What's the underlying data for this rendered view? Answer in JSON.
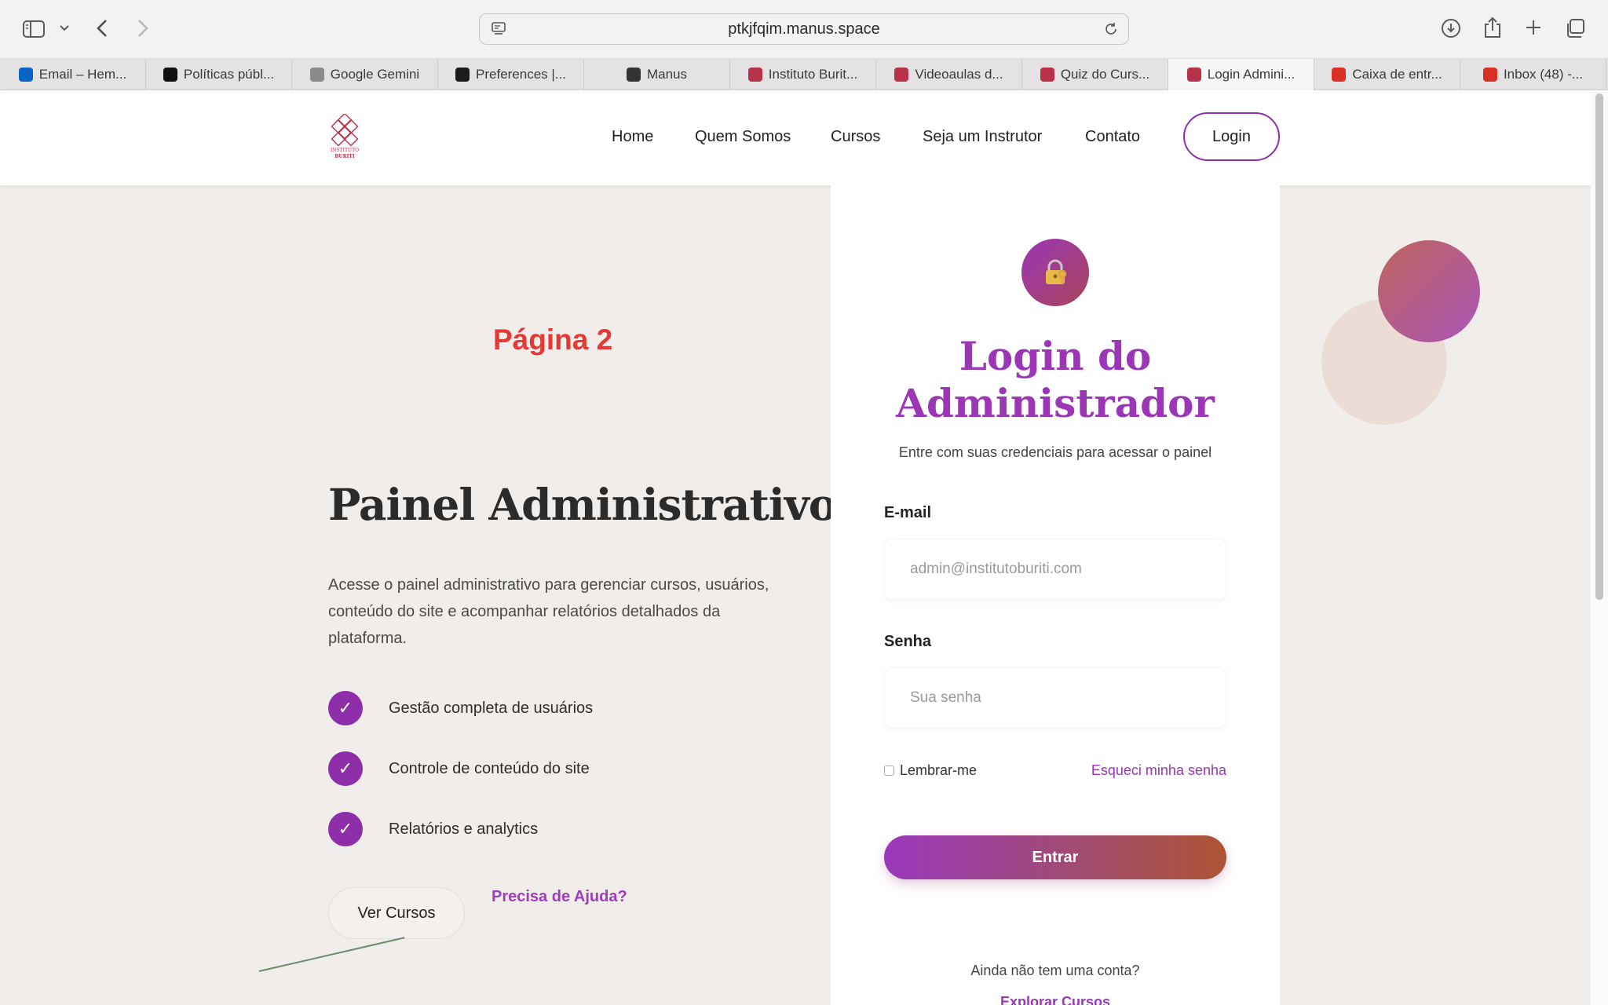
{
  "browser": {
    "url": "ptkjfqim.manus.space",
    "tabs": [
      {
        "label": "Email – Hem...",
        "icon": "outlook-icon",
        "color": "#0a64c4"
      },
      {
        "label": "Políticas públ...",
        "icon": "openai-icon",
        "color": "#111111"
      },
      {
        "label": "Google Gemini",
        "icon": "gemini-icon",
        "color": "#8a8a8a"
      },
      {
        "label": "Preferences |...",
        "icon": "bolt-icon",
        "color": "#1b1b1b"
      },
      {
        "label": "Manus",
        "icon": "manus-icon",
        "color": "#333333"
      },
      {
        "label": "Instituto Burit...",
        "icon": "buriti-icon",
        "color": "#b8334a"
      },
      {
        "label": "Videoaulas d...",
        "icon": "buriti-icon",
        "color": "#b8334a"
      },
      {
        "label": "Quiz do Curs...",
        "icon": "buriti-icon",
        "color": "#b8334a"
      },
      {
        "label": "Login Admini...",
        "icon": "buriti-icon",
        "color": "#b8334a"
      },
      {
        "label": "Caixa de entr...",
        "icon": "gmail-icon",
        "color": "#d93025"
      },
      {
        "label": "Inbox (48) -...",
        "icon": "gmail-icon",
        "color": "#d93025"
      }
    ],
    "active_tab_index": 8
  },
  "site": {
    "logo_text_1": "INSTITUTO",
    "logo_text_2": "BURITI",
    "nav": {
      "home": "Home",
      "quem_somos": "Quem Somos",
      "cursos": "Cursos",
      "instrutor": "Seja um Instrutor",
      "contato": "Contato",
      "login": "Login"
    }
  },
  "hero": {
    "page_label": "Página 2",
    "title": "Painel Administrativo",
    "description": "Acesse o painel administrativo para gerenciar cursos, usuários, conteúdo do site e acompanhar relatórios detalhados da plataforma.",
    "features": [
      "Gestão completa de usuários",
      "Controle de conteúdo do site",
      "Relatórios e analytics"
    ],
    "check_glyph": "✓",
    "ver_cursos": "Ver Cursos",
    "ajuda": "Precisa de Ajuda?"
  },
  "login_card": {
    "title": "Login do Administrador",
    "subtitle": "Entre com suas credenciais para acessar o painel",
    "email_label": "E-mail",
    "email_placeholder": "admin@institutoburiti.com",
    "senha_label": "Senha",
    "senha_placeholder": "Sua senha",
    "remember": "Lembrar-me",
    "remember_checked": false,
    "forgot": "Esqueci minha senha",
    "submit": "Entrar",
    "no_account": "Ainda não tem uma conta?",
    "explore": "Explorar Cursos"
  },
  "colors": {
    "accent": "#9b36b7",
    "page_label": "#e53935",
    "background": "#f0edea"
  }
}
